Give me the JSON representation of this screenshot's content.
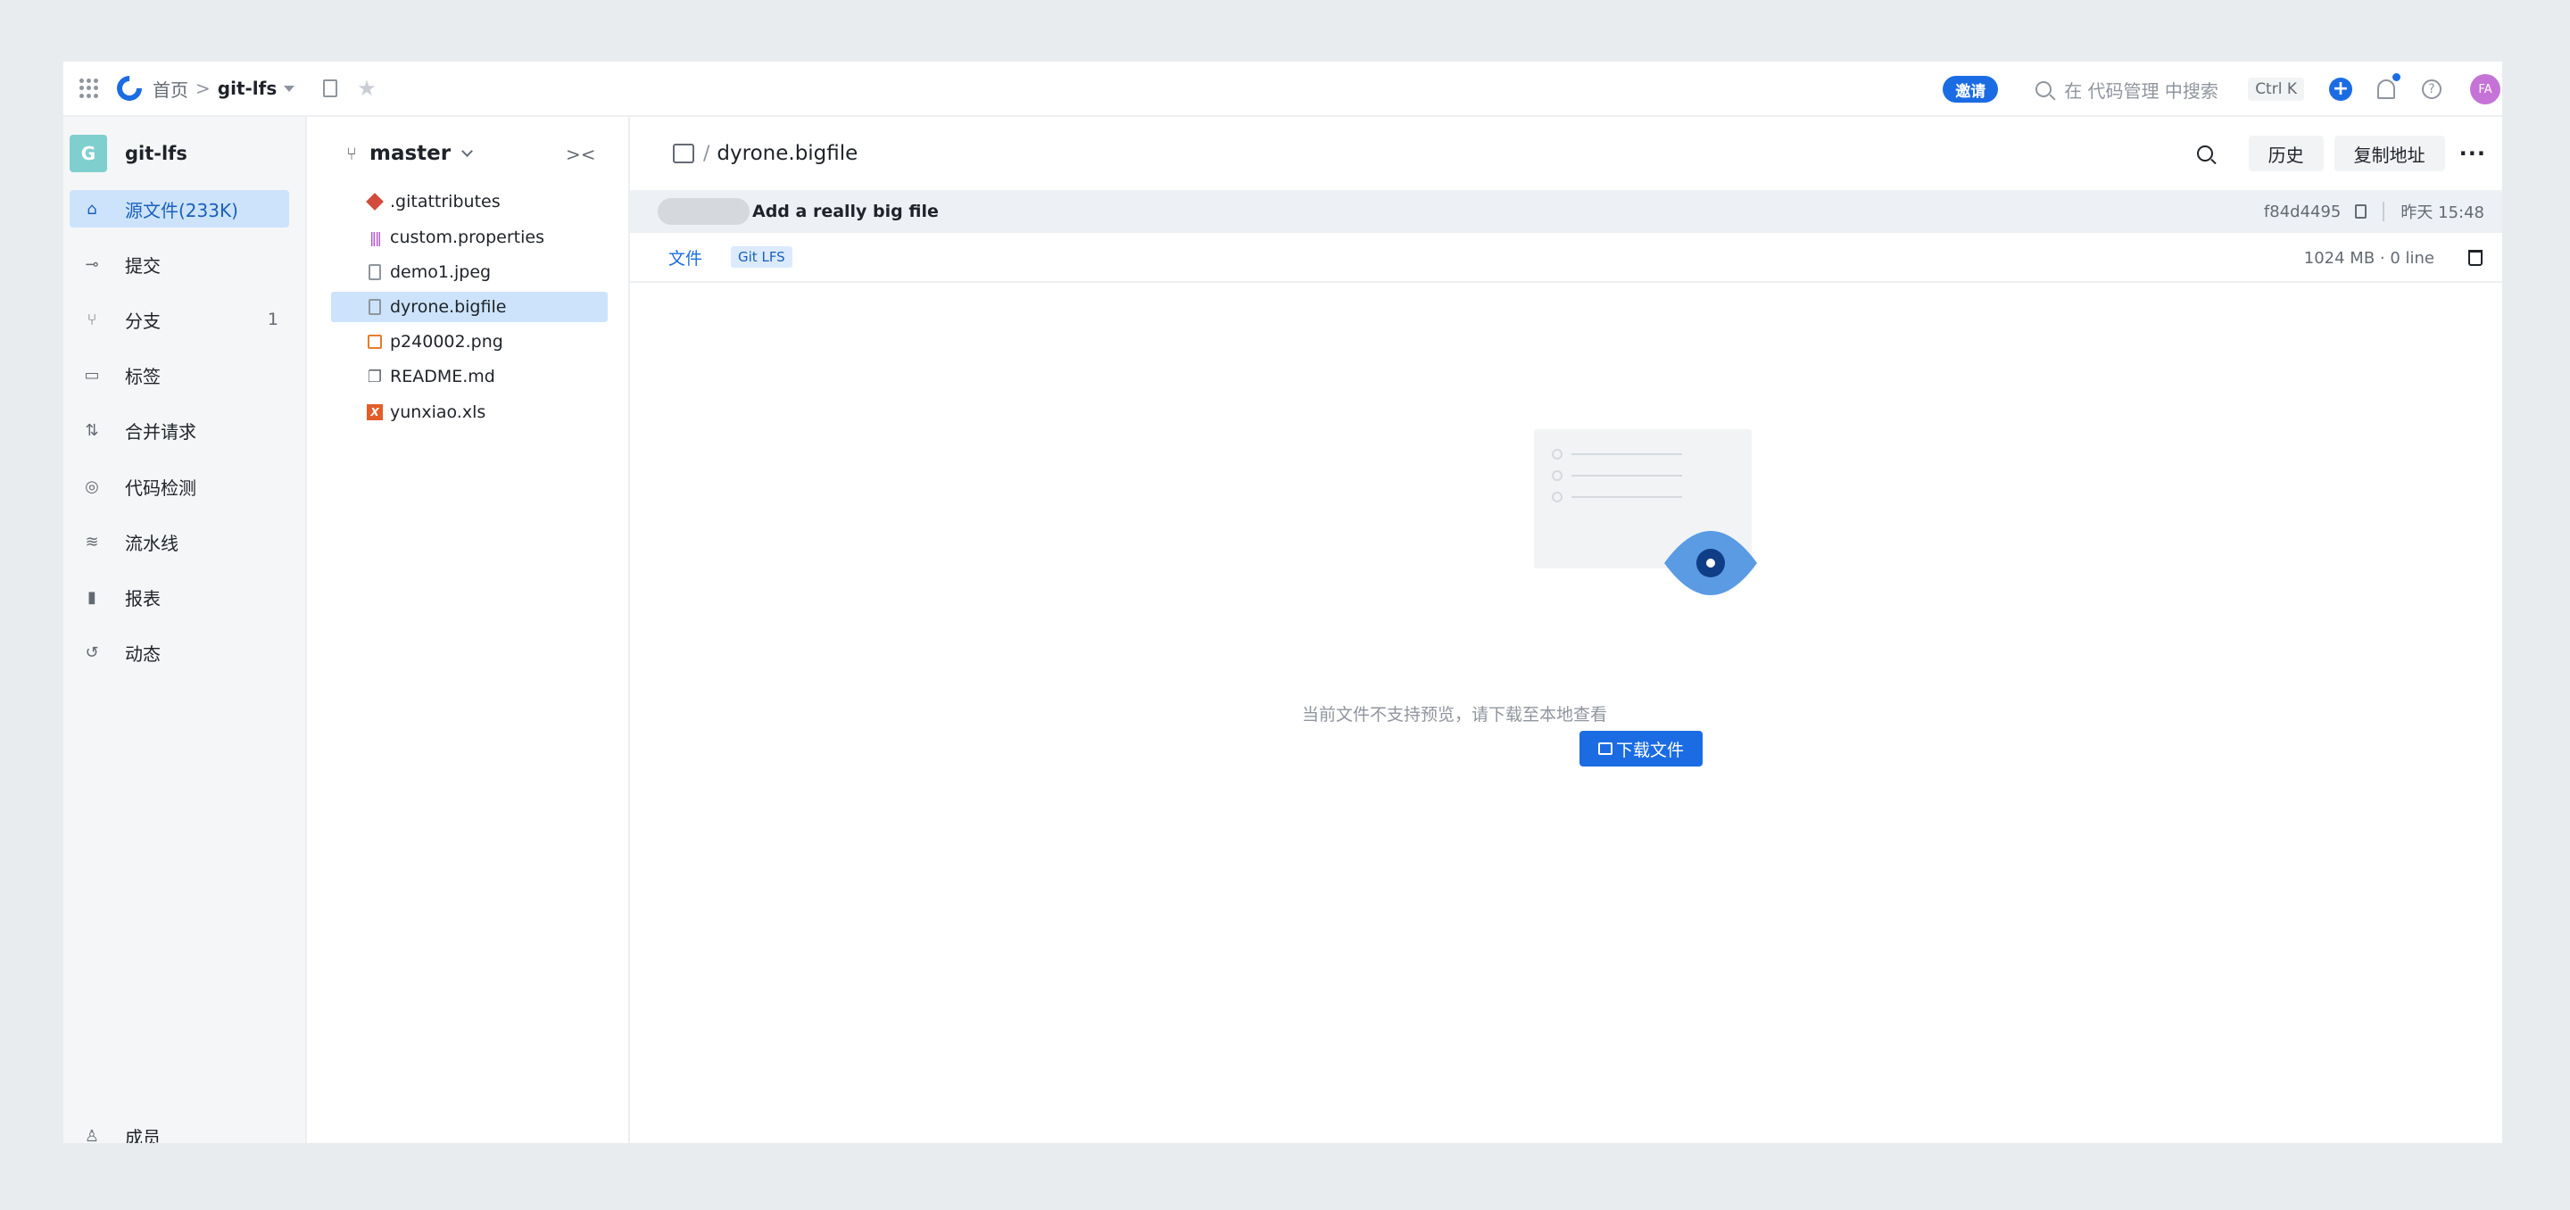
{
  "topbar": {
    "breadcrumb_home": "首页",
    "breadcrumb_sep": ">",
    "repo": "git-lfs",
    "invite_label": "邀请",
    "search_placeholder": "在 代码管理 中搜索",
    "shortcut": "Ctrl K",
    "avatar_initials": "FA",
    "accent_color": "#1b6ce3"
  },
  "sidebar": {
    "repo_initial": "G",
    "repo_name": "git-lfs",
    "items": [
      {
        "label": "源文件(233K)",
        "icon": "code-home-icon",
        "active": true
      },
      {
        "label": "提交",
        "icon": "commit-icon"
      },
      {
        "label": "分支",
        "icon": "branch-icon",
        "count": "1"
      },
      {
        "label": "标签",
        "icon": "tag-icon"
      },
      {
        "label": "合并请求",
        "icon": "merge-request-icon"
      },
      {
        "label": "代码检测",
        "icon": "scan-icon"
      },
      {
        "label": "流水线",
        "icon": "pipeline-icon"
      },
      {
        "label": "报表",
        "icon": "chart-icon"
      },
      {
        "label": "动态",
        "icon": "history-icon"
      }
    ],
    "bottom_label": "成员"
  },
  "tree": {
    "branch": "master",
    "files": [
      {
        "name": ".gitattributes",
        "type": "git"
      },
      {
        "name": "custom.properties",
        "type": "properties"
      },
      {
        "name": "demo1.jpeg",
        "type": "doc"
      },
      {
        "name": "dyrone.bigfile",
        "type": "doc",
        "active": true
      },
      {
        "name": "p240002.png",
        "type": "image"
      },
      {
        "name": "README.md",
        "type": "book"
      },
      {
        "name": "yunxiao.xls",
        "type": "xls"
      }
    ]
  },
  "main": {
    "path_sep": "/",
    "file_name": "dyrone.bigfile",
    "history_button": "历史",
    "copy_url_button": "复制地址",
    "more": "···",
    "commit": {
      "message": "Add a really big file",
      "sha": "f84d4495",
      "time": "昨天 15:48"
    },
    "tab_label": "文件",
    "lfs_badge": "Git LFS",
    "file_meta": "1024 MB · 0 line",
    "empty_message": "当前文件不支持预览，请下载至本地查看",
    "download_button": "下载文件"
  }
}
